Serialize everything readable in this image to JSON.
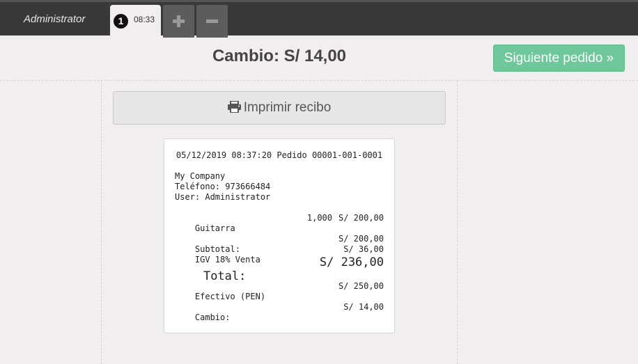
{
  "topbar": {
    "user": "Administrator",
    "order_number": "1",
    "order_time": "08:33",
    "add_icon": "plus-icon",
    "remove_icon": "minus-icon"
  },
  "header": {
    "change_title": "Cambio: S/ 14,00",
    "next_order_label": "Siguiente pedido »"
  },
  "print_button": {
    "label": "Imprimir recibo",
    "icon": "printer-icon"
  },
  "receipt": {
    "header_line": "05/12/2019 08:37:20 Pedido 00001-001-0001",
    "company": "My Company",
    "phone": "Teléfono: 973666484",
    "user": "User: Administrator",
    "item_name": "Guitarra",
    "item_qty": "1,000",
    "item_price": "S/ 200,00",
    "subtotal_label": "Subtotal:",
    "subtotal_value": "S/ 200,00",
    "tax_label": "IGV 18% Venta",
    "tax_value": "S/ 36,00",
    "total_label": "Total:",
    "total_value": "S/ 236,00",
    "cash_label": "Efectivo (PEN)",
    "cash_value": "S/ 250,00",
    "change_label": "Cambio:",
    "change_value": "S/ 14,00"
  },
  "colors": {
    "topbar": "#393939",
    "next_button": "#6ec89b",
    "background": "#f0eeee"
  }
}
